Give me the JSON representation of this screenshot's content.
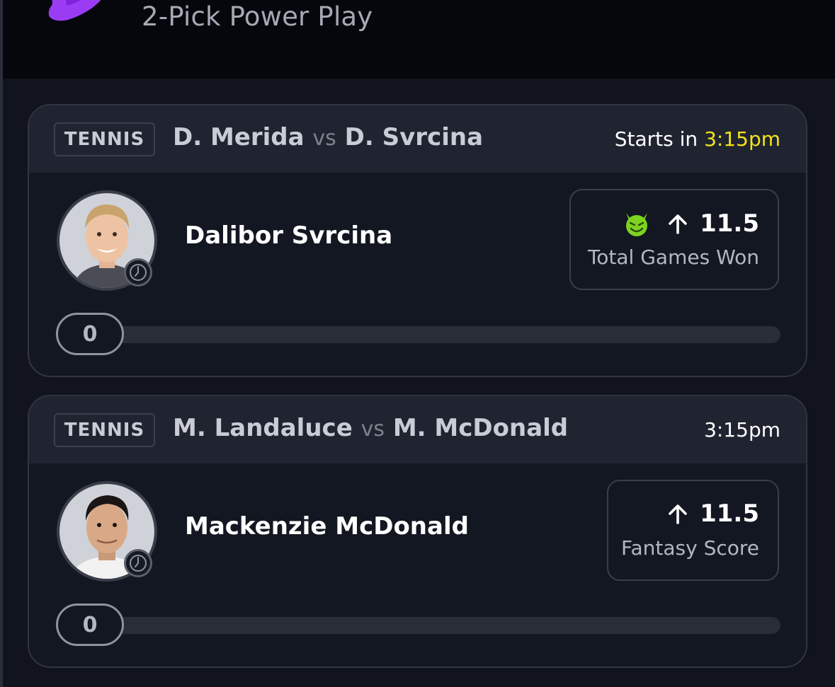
{
  "header": {
    "entry_title": "2-Pick Power Play"
  },
  "colors": {
    "background": "#11141e",
    "card_header": "#202430",
    "accent_purple": "#9b3cf5",
    "time_highlight": "#f4e21c"
  },
  "picks": [
    {
      "sport": "TENNIS",
      "player_a": "D. Merida",
      "vs": "vs",
      "player_b": "D. Svrcina",
      "start_prefix": "Starts in ",
      "start_time": "3:15pm",
      "player_name": "Dalibor Svrcina",
      "icon": "demon-face-icon",
      "direction": "up-arrow-icon",
      "line_value": "11.5",
      "stat_label": "Total Games Won",
      "progress_value": "0"
    },
    {
      "sport": "TENNIS",
      "player_a": "M. Landaluce",
      "vs": "vs",
      "player_b": "M. McDonald",
      "start_prefix": "",
      "start_time": "3:15pm",
      "player_name": "Mackenzie McDonald",
      "icon": "",
      "direction": "up-arrow-icon",
      "line_value": "11.5",
      "stat_label": "Fantasy Score",
      "progress_value": "0"
    }
  ]
}
